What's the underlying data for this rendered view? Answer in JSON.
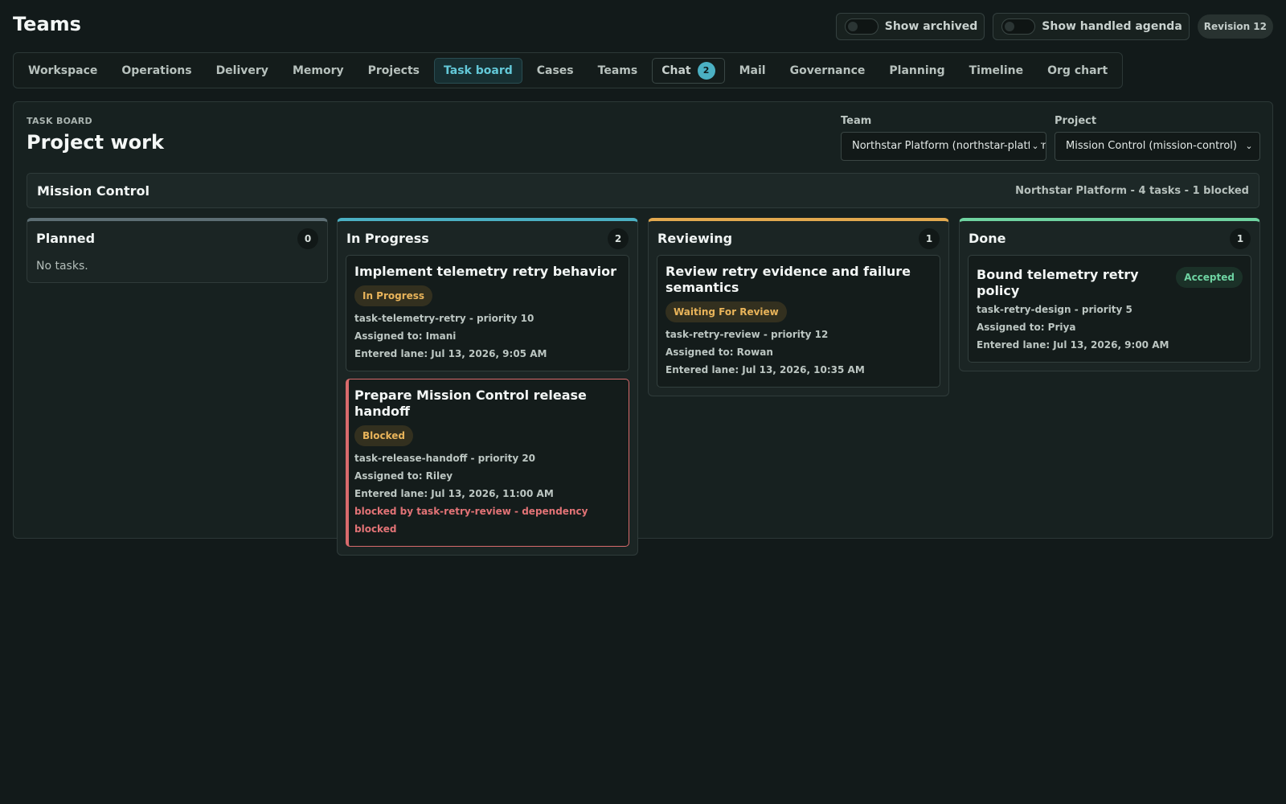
{
  "app": {
    "title": "Teams"
  },
  "top_controls": {
    "show_archived": {
      "label": "Show archived",
      "on": false
    },
    "show_handled_agenda": {
      "label": "Show handled agenda",
      "on": false
    },
    "revision": "Revision 12"
  },
  "tabs": [
    {
      "label": "Workspace"
    },
    {
      "label": "Operations"
    },
    {
      "label": "Delivery"
    },
    {
      "label": "Memory"
    },
    {
      "label": "Projects"
    },
    {
      "label": "Task board",
      "active": true
    },
    {
      "label": "Cases"
    },
    {
      "label": "Teams"
    },
    {
      "label": "Chat",
      "badge": "2"
    },
    {
      "label": "Mail"
    },
    {
      "label": "Governance"
    },
    {
      "label": "Planning"
    },
    {
      "label": "Timeline"
    },
    {
      "label": "Org chart"
    }
  ],
  "board": {
    "eyebrow": "TASK BOARD",
    "title": "Project work",
    "team_filter": {
      "label": "Team",
      "value": "Northstar Platform (northstar-platform)"
    },
    "project_filter": {
      "label": "Project",
      "value": "Mission Control (mission-control)"
    },
    "project": {
      "name": "Mission Control",
      "summary": "Northstar Platform - 4 tasks - 1 blocked"
    },
    "lanes": {
      "planned": {
        "title": "Planned",
        "count": "0",
        "empty_text": "No tasks.",
        "color": "#5d6e74"
      },
      "in_progress": {
        "title": "In Progress",
        "count": "2",
        "color": "#4bb0c3",
        "cards": [
          {
            "title": "Implement telemetry retry behavior",
            "status": "In Progress",
            "id_priority": "task-telemetry-retry - priority 10",
            "assigned": "Assigned to: Imani",
            "entered": "Entered lane: Jul 13, 2026, 9:05 AM"
          },
          {
            "title": "Prepare Mission Control release handoff",
            "status": "Blocked",
            "id_priority": "task-release-handoff - priority 20",
            "assigned": "Assigned to: Riley",
            "entered": "Entered lane: Jul 13, 2026, 11:00 AM",
            "blocker": "blocked by task-retry-review - dependency blocked"
          }
        ]
      },
      "reviewing": {
        "title": "Reviewing",
        "count": "1",
        "color": "#e2a94f",
        "cards": [
          {
            "title": "Review retry evidence and failure semantics",
            "status": "Waiting For Review",
            "id_priority": "task-retry-review - priority 12",
            "assigned": "Assigned to: Rowan",
            "entered": "Entered lane: Jul 13, 2026, 10:35 AM"
          }
        ]
      },
      "done": {
        "title": "Done",
        "count": "1",
        "color": "#6fd3a0",
        "cards": [
          {
            "title": "Bound telemetry retry policy",
            "status": "Accepted",
            "id_priority": "task-retry-design - priority 5",
            "assigned": "Assigned to: Priya",
            "entered": "Entered lane: Jul 13, 2026, 9:00 AM"
          }
        ]
      }
    }
  }
}
